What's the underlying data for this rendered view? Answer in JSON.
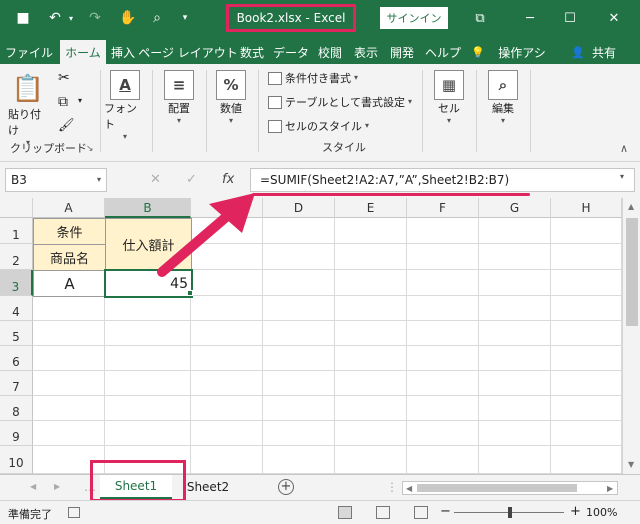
{
  "window": {
    "title": "Book2.xlsx  -  Excel",
    "signin_label": "サインイン",
    "minimize_glyph": "─",
    "maximize_glyph": "☐",
    "close_glyph": "✕",
    "restore_glyph": "⧉"
  },
  "quick_access": {
    "save_glyph": "■",
    "undo_glyph": "↶",
    "redo_glyph": "↷",
    "touch_glyph": "✋",
    "preview_glyph": "⌕",
    "customize_glyph": "▾"
  },
  "tabs": [
    "ファイル",
    "ホーム",
    "挿入",
    "ページ レイアウト",
    "数式",
    "データ",
    "校閲",
    "表示",
    "開発",
    "ヘルプ",
    "操作アシ",
    "共有"
  ],
  "tell_me_glyph": "💡",
  "share_glyph": "👤",
  "ribbon": {
    "clipboard": {
      "paste_label": "貼り付け",
      "group_label": "クリップボード",
      "launcher_glyph": "↘",
      "cut_glyph": "✂",
      "copy_glyph": "⧉",
      "format_glyph": "🖌",
      "paste_glyph": "📋"
    },
    "font": {
      "label": "フォント",
      "glyph": "A"
    },
    "alignment": {
      "label": "配置",
      "glyph": "≡"
    },
    "number": {
      "label": "数値",
      "glyph": "%"
    },
    "styles": {
      "conditional": "条件付き書式",
      "table": "テーブルとして書式設定",
      "cell_style": "セルのスタイル",
      "group_label": "スタイル"
    },
    "cells": {
      "label": "セル",
      "glyph": "▦"
    },
    "editing": {
      "label": "編集",
      "glyph": "⌕"
    },
    "collapse_glyph": "∧",
    "caret_glyph": "▾"
  },
  "formula_bar": {
    "name_box": "B3",
    "cancel_glyph": "✕",
    "enter_glyph": "✓",
    "fx_glyph": "fx",
    "formula": "=SUMIF(Sheet2!A2:A7,”A”,Sheet2!B2:B7)"
  },
  "grid": {
    "columns": [
      "A",
      "B",
      "C",
      "D",
      "E",
      "F",
      "G",
      "H"
    ],
    "rows": [
      "1",
      "2",
      "3",
      "4",
      "5",
      "6",
      "7",
      "8",
      "9",
      "10"
    ],
    "cells": {
      "A1": "条件",
      "A2": "商品名",
      "A3": "A",
      "B12": "仕入額計",
      "B3": "45"
    }
  },
  "sheets": {
    "tabs": [
      "Sheet1",
      "Sheet2"
    ],
    "active": "Sheet1"
  },
  "status": {
    "text": "準備完了",
    "zoom": "100%",
    "zoom_out": "−",
    "zoom_in": "+"
  },
  "colors": {
    "excel_green": "#217346",
    "highlight": "#e0245e",
    "header_fill": "#fff2cc"
  }
}
